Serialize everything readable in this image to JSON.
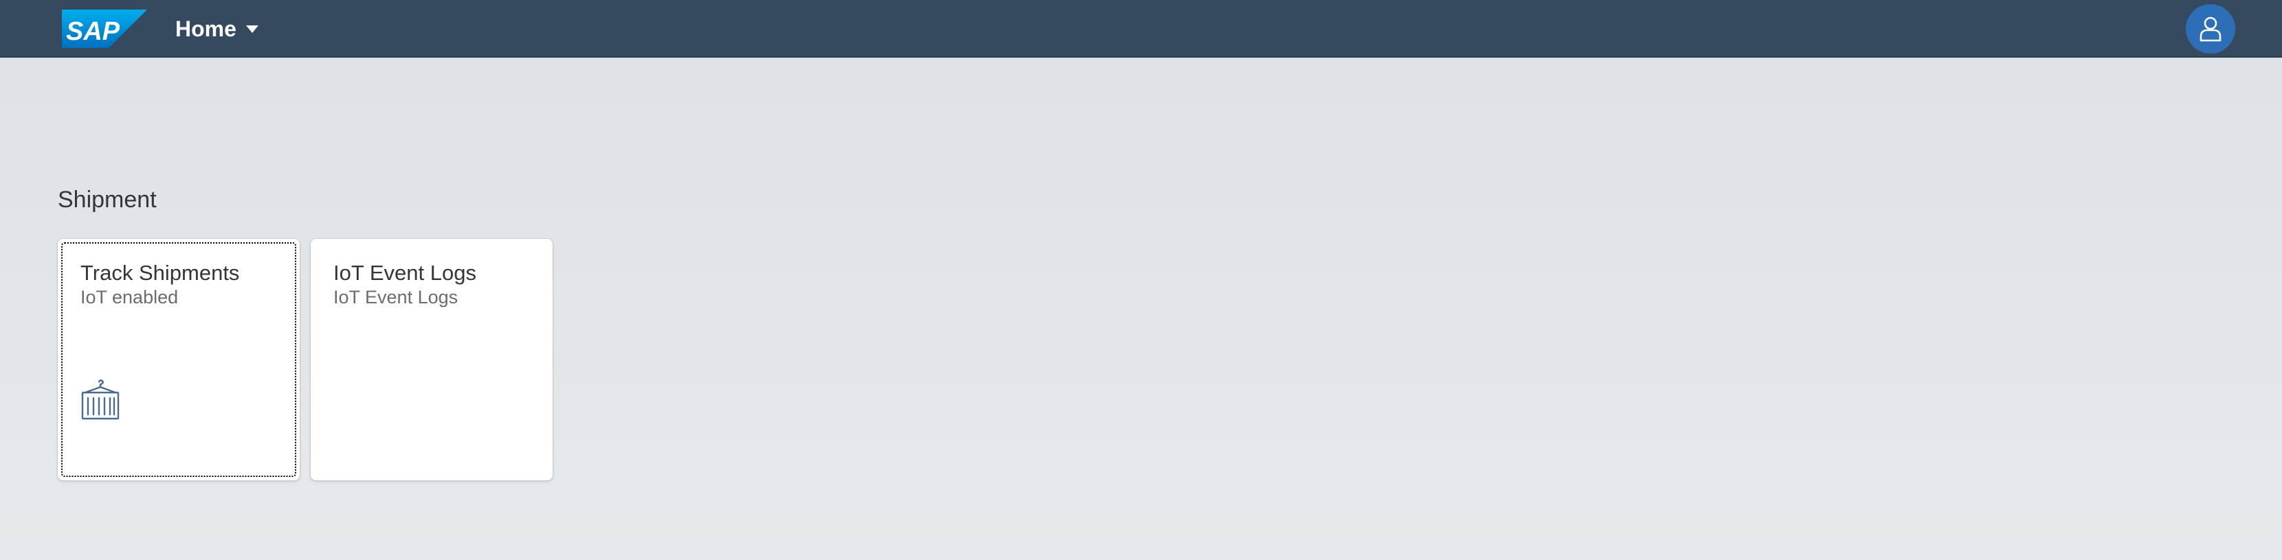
{
  "shell": {
    "logo_text": "SAP",
    "home_label": "Home",
    "brand_color": "#354a5f",
    "avatar_color": "#2c6fb6"
  },
  "group": {
    "title": "Shipment",
    "tiles": [
      {
        "title": "Track Shipments",
        "subtitle": "IoT enabled",
        "icon": "shipping-container-icon",
        "focused": true
      },
      {
        "title": "IoT Event Logs",
        "subtitle": "IoT Event Logs",
        "icon": null,
        "focused": false
      }
    ]
  }
}
